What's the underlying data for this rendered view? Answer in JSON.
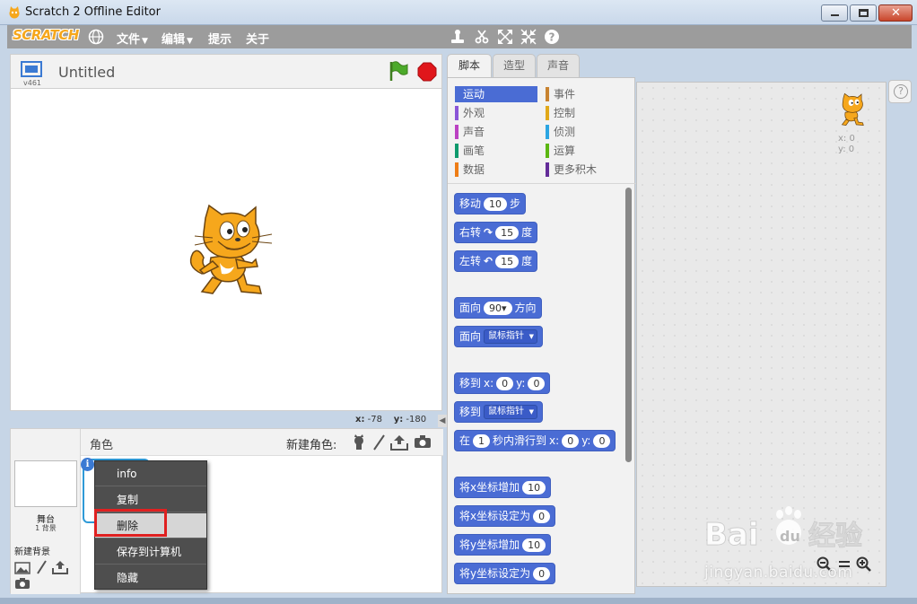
{
  "window": {
    "title": "Scratch 2 Offline Editor",
    "icon": "scratch-cat-icon",
    "controls": [
      "minimize-icon",
      "maximize-icon",
      "close-icon"
    ]
  },
  "menubar": {
    "logo": "SCRATCH",
    "globe_icon": "globe-icon",
    "menus": [
      {
        "label": "文件",
        "has_caret": true
      },
      {
        "label": "编辑",
        "has_caret": true
      },
      {
        "label": "提示",
        "has_caret": false
      },
      {
        "label": "关于",
        "has_caret": false
      }
    ],
    "tools": [
      "duplicate-stamp-icon",
      "cut-scissors-icon",
      "grow-icon",
      "shrink-icon",
      "help-icon"
    ]
  },
  "stage": {
    "version": "v461",
    "project_title": "Untitled",
    "coords_x_label": "x:",
    "coords_x": "-78",
    "coords_y_label": "y:",
    "coords_y": "-180"
  },
  "sprites": {
    "header_label": "角色",
    "new_sprite_label": "新建角色:",
    "stage_label": "舞台",
    "backdrop_count": "1 背景",
    "new_backdrop_label": "新建背景",
    "info_glyph": "i"
  },
  "context_menu": {
    "items": [
      {
        "label": "info"
      },
      {
        "label": "复制"
      },
      {
        "label": "删除"
      },
      {
        "label": "保存到计算机"
      },
      {
        "label": "隐藏"
      }
    ]
  },
  "tabs": [
    {
      "label": "脚本"
    },
    {
      "label": "造型"
    },
    {
      "label": "声音"
    }
  ],
  "categories": {
    "left": [
      {
        "label": "运动",
        "color": "#4a6cd4"
      },
      {
        "label": "外观",
        "color": "#8a55d7"
      },
      {
        "label": "声音",
        "color": "#bb42c3"
      },
      {
        "label": "画笔",
        "color": "#0e9a6c"
      },
      {
        "label": "数据",
        "color": "#ee7d16"
      }
    ],
    "right": [
      {
        "label": "事件",
        "color": "#c88330"
      },
      {
        "label": "控制",
        "color": "#e1a91a"
      },
      {
        "label": "侦测",
        "color": "#2ca5e2"
      },
      {
        "label": "运算",
        "color": "#5cb712"
      },
      {
        "label": "更多积木",
        "color": "#632d99"
      }
    ]
  },
  "blocks": {
    "move": {
      "pre": "移动",
      "value": "10",
      "post": "步"
    },
    "turn_right": {
      "pre": "右转",
      "value": "15",
      "post": "度"
    },
    "turn_left": {
      "pre": "左转",
      "value": "15",
      "post": "度"
    },
    "point_direction": {
      "pre": "面向",
      "value": "90▾",
      "post": "方向"
    },
    "point_towards": {
      "pre": "面向",
      "dropdown": "鼠标指针"
    },
    "goto_xy": {
      "pre": "移到",
      "x_label": "x:",
      "x": "0",
      "y_label": "y:",
      "y": "0"
    },
    "goto": {
      "pre": "移到",
      "dropdown": "鼠标指针"
    },
    "glide": {
      "pre": "在",
      "secs": "1",
      "mid": "秒内滑行到",
      "x_label": "x:",
      "x": "0",
      "y_label": "y:",
      "y": "0"
    },
    "change_x": {
      "pre": "将x坐标增加",
      "value": "10"
    },
    "set_x": {
      "pre": "将x坐标设定为",
      "value": "0"
    },
    "change_y": {
      "pre": "将y坐标增加",
      "value": "10"
    },
    "set_y": {
      "pre": "将y坐标设定为",
      "value": "0"
    }
  },
  "script_area": {
    "x_label": "x: 0",
    "y_label": "y: 0",
    "zoom": [
      "zoom-out-icon",
      "zoom-reset-icon",
      "zoom-in-icon"
    ]
  },
  "watermark": {
    "brand": "Bai du 经验",
    "url": "jingyan.baidu.com"
  }
}
